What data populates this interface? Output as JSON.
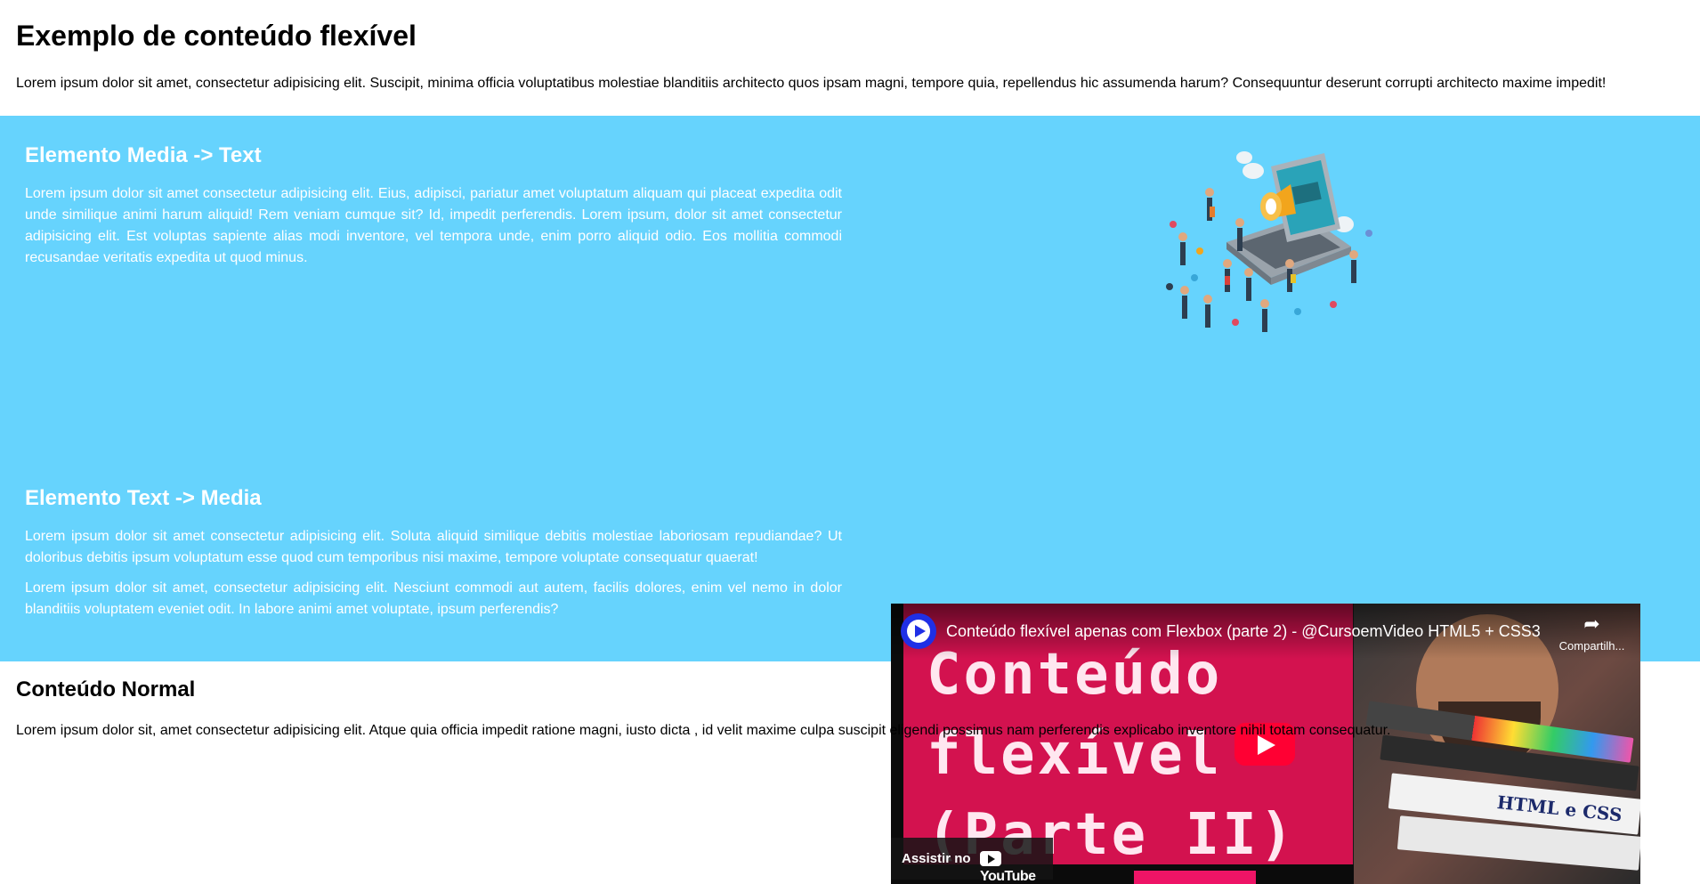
{
  "page": {
    "title": "Exemplo de conteúdo flexível",
    "intro": "Lorem ipsum dolor sit amet, consectetur adipisicing elit. Suscipit, minima officia voluptatibus molestiae blanditiis architecto quos ipsam magni, tempore quia, repellendus hic assumenda harum? Consequuntur deserunt corrupti architecto maxime impedit!"
  },
  "colors": {
    "band": "#66d3fd",
    "band_text": "#ffffff",
    "yt_red": "#ff0033"
  },
  "media_text": {
    "heading": "Elemento Media -> Text",
    "paragraph": "Lorem ipsum dolor sit amet consectetur adipisicing elit. Eius, adipisci, pariatur amet voluptatum aliquam qui placeat expedita odit unde similique animi harum aliquid! Rem veniam cumque sit? Id, impedit perferendis. Lorem ipsum, dolor sit amet consectetur adipisicing elit. Est voluptas sapiente alias modi inventore, vel tempora unde, enim porro aliquid odio. Eos mollitia commodi recusandae veritatis expedita ut quod minus.",
    "illustration_icon": "laptop-megaphone-people-illustration"
  },
  "text_media": {
    "heading": "Elemento Text -> Media",
    "paragraph1": "Lorem ipsum dolor sit amet consectetur adipisicing elit. Soluta aliquid similique debitis molestiae laboriosam repudiandae? Ut doloribus debitis ipsum voluptatum esse quod cum temporibus nisi maxime, tempore voluptate consequatur quaerat!",
    "paragraph2": "Lorem ipsum dolor sit amet, consectetur adipisicing elit. Nesciunt commodi aut autem, facilis dolores, enim vel nemo in dolor blanditiis voluptatem eveniet odit. In labore animi amet voluptate, ipsum perferendis?"
  },
  "video": {
    "title": "Conteúdo flexível apenas com Flexbox (parte 2) - @CursoemVideo HTML5 + CSS3",
    "share_label": "Compartilh...",
    "watch_label": "Assistir no",
    "yt_brand": "YouTube",
    "thumb_text": "Conteúdo\nflexível\n(Parte II)",
    "book_label": "HTML e CSS",
    "icons": [
      "channel-logo-icon",
      "share-icon",
      "play-icon",
      "youtube-logo-icon"
    ]
  },
  "normal": {
    "heading": "Conteúdo Normal",
    "paragraph": "Lorem ipsum dolor sit, amet consectetur adipisicing elit. Atque quia officia impedit ratione magni, iusto dicta , id velit maxime culpa suscipit eligendi possimus nam perferendis explicabo inventore nihil totam consequatur."
  }
}
